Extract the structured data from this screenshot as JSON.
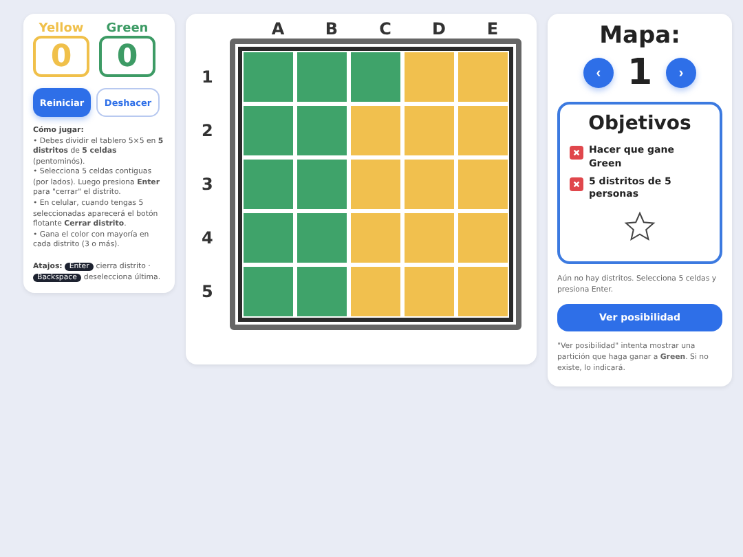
{
  "scores": [
    {
      "name": "Yellow",
      "value": "0",
      "color": "#f0c04a"
    },
    {
      "name": "Green",
      "value": "0",
      "color": "#3d9b65"
    }
  ],
  "buttons": [
    {
      "label": "Reiniciar",
      "kind": "primary"
    },
    {
      "label": "Deshacer",
      "kind": "secondary"
    }
  ],
  "help": {
    "title": "Cómo jugar:",
    "lines": [
      "• Debes dividir el tablero 5×5 en **5 distritos** de **5 celdas** (pentominós).",
      "• Selecciona 5 celdas contiguas (por lados). Luego presiona **Enter** para \"cerrar\" el distrito.",
      "• En celular, cuando tengas 5 seleccionadas aparecerá el botón flotante **Cerrar distrito**.",
      "• Gana el color con mayoría en cada distrito (3 o más)."
    ]
  },
  "shortcuts": {
    "label": "Atajos:",
    "parts": [
      {
        "kind": "key",
        "text": "Enter"
      },
      {
        "kind": "text",
        "text": "cierra distrito ·"
      },
      {
        "kind": "key",
        "text": "Backspace"
      },
      {
        "kind": "text",
        "text": "deselecciona última."
      }
    ]
  },
  "board": {
    "columns": [
      "A",
      "B",
      "C",
      "D",
      "E"
    ],
    "rows": [
      {
        "label": "1",
        "cells": [
          {
            "color": "#3fa36a"
          },
          {
            "color": "#3fa36a"
          },
          {
            "color": "#3fa36a"
          },
          {
            "color": "#f1c04e"
          },
          {
            "color": "#f1c04e"
          }
        ]
      },
      {
        "label": "2",
        "cells": [
          {
            "color": "#3fa36a"
          },
          {
            "color": "#3fa36a"
          },
          {
            "color": "#f1c04e"
          },
          {
            "color": "#f1c04e"
          },
          {
            "color": "#f1c04e"
          }
        ]
      },
      {
        "label": "3",
        "cells": [
          {
            "color": "#3fa36a"
          },
          {
            "color": "#3fa36a"
          },
          {
            "color": "#f1c04e"
          },
          {
            "color": "#f1c04e"
          },
          {
            "color": "#f1c04e"
          }
        ]
      },
      {
        "label": "4",
        "cells": [
          {
            "color": "#3fa36a"
          },
          {
            "color": "#3fa36a"
          },
          {
            "color": "#f1c04e"
          },
          {
            "color": "#f1c04e"
          },
          {
            "color": "#f1c04e"
          }
        ]
      },
      {
        "label": "5",
        "cells": [
          {
            "color": "#3fa36a"
          },
          {
            "color": "#3fa36a"
          },
          {
            "color": "#f1c04e"
          },
          {
            "color": "#f1c04e"
          },
          {
            "color": "#f1c04e"
          }
        ]
      }
    ]
  },
  "map": {
    "title": "Mapa:",
    "number": "1",
    "prev": "‹",
    "next": "›"
  },
  "objectives": {
    "title": "Objetivos",
    "items": [
      {
        "text": "Hacer que gane Green",
        "done": false
      },
      {
        "text": "5 distritos de 5 personas",
        "done": false
      }
    ],
    "star_earned": false
  },
  "status": "Aún no hay distritos. Selecciona 5 celdas y presiona Enter.",
  "action": "Ver posibilidad",
  "note": "\"Ver posibilidad\" intenta mostrar una partición que haga ganar a **Green**. Si no existe, lo indicará."
}
